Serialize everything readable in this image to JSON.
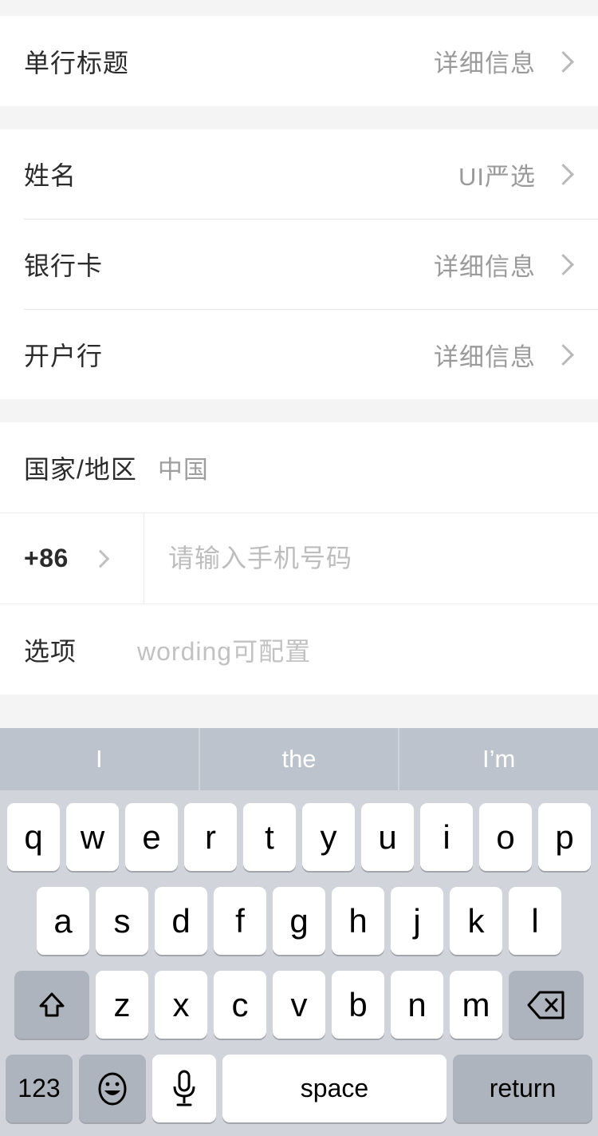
{
  "theme": {
    "page_bg": "#f4f4f5",
    "card_bg": "#ffffff",
    "label_color": "#2b2b2b",
    "value_color": "#9a9a9a",
    "placeholder_color": "#bdbdbd",
    "keyboard_bg": "#d1d5db",
    "suggestion_bg": "#bcc3cc",
    "key_bg": "#ffffff",
    "key_dark_bg": "#aeb4bd"
  },
  "form": {
    "section1": {
      "rows": [
        {
          "label": "单行标题",
          "value": "详细信息",
          "accessory": "chevron-right-icon"
        }
      ]
    },
    "section2": {
      "rows": [
        {
          "label": "姓名",
          "value": "UI严选",
          "accessory": "chevron-right-icon"
        },
        {
          "label": "银行卡",
          "value": "详细信息",
          "accessory": "chevron-right-icon"
        },
        {
          "label": "开户行",
          "value": "详细信息",
          "accessory": "chevron-right-icon"
        }
      ]
    },
    "section3": {
      "country_row": {
        "label": "国家/地区",
        "value": "中国"
      },
      "phone_row": {
        "country_code": "+86",
        "accessory": "chevron-right-icon",
        "input_value": "",
        "input_placeholder": "请输入手机号码"
      },
      "option_row": {
        "label": "选项",
        "value": "wording可配置"
      }
    }
  },
  "keyboard": {
    "suggestions": [
      "I",
      "the",
      "I’m"
    ],
    "row1": [
      "q",
      "w",
      "e",
      "r",
      "t",
      "y",
      "u",
      "i",
      "o",
      "p"
    ],
    "row2": [
      "a",
      "s",
      "d",
      "f",
      "g",
      "h",
      "j",
      "k",
      "l"
    ],
    "row3": {
      "shift_icon": "shift-arrow-up-icon",
      "letters": [
        "z",
        "x",
        "c",
        "v",
        "b",
        "n",
        "m"
      ],
      "backspace_icon": "backspace-delete-icon"
    },
    "row4": {
      "numeric_label": "123",
      "emoji_icon": "emoji-smiley-icon",
      "mic_icon": "microphone-icon",
      "space_label": "space",
      "return_label": "return"
    }
  }
}
